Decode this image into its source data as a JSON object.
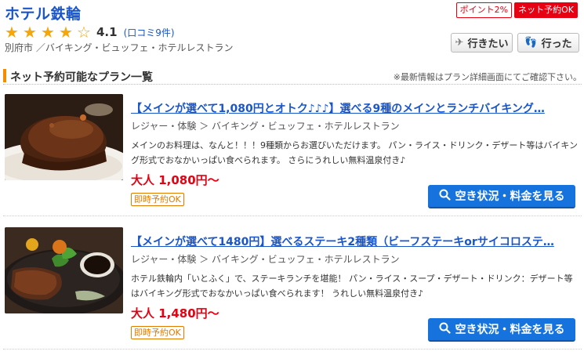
{
  "shop": {
    "name": "ホテル鉄輪",
    "rating": "4.1",
    "stars_filled": 4,
    "stars_total": 5,
    "review_link": "(口コミ9件)",
    "breadcrumb": "別府市 ／バイキング・ビュッフェ・ホテルレストラン"
  },
  "badges": {
    "point": "ポイント2%",
    "net": "ネット予約OK"
  },
  "actions": {
    "want_label": "行きたい",
    "went_label": "行った"
  },
  "section": {
    "title": "ネット予約可能なプラン一覧",
    "note": "※最新情報はプラン詳細画面にてご確認下さい。"
  },
  "plans": [
    {
      "title": "【メインが選べて1,080円とオトク♪♪♪】選べる9種のメインとランチバイキング…",
      "category": "レジャー・体験 ＞ バイキング・ビュッフェ・ホテルレストラン",
      "description": "メインのお料理は、なんと！！！9種類からお選びいただけます。 パン・ライス・ドリンク・デザート等はバイキング形式でおなかいっぱい食べられます。 さらにうれしい無料温泉付き♪",
      "price": "大人 1,080円～",
      "tag": "即時予約OK",
      "button": "空き状況・料金を見る",
      "image_icon": "hamburg-steak-photo"
    },
    {
      "title": "【メインが選べて1480円】選べるステーキ2種類（ビーフステーキorサイコロステ…",
      "category": "レジャー・体験 ＞ バイキング・ビュッフェ・ホテルレストラン",
      "description": "ホテル鉄輪内「いとふく」で、ステーキランチを堪能！ パン・ライス・スープ・デザート・ドリンク：デザート等はバイキング形式でおなかいっぱい食べられます！ うれしい無料温泉付き♪",
      "price": "大人 1,480円～",
      "tag": "即時予約OK",
      "button": "空き状況・料金を見る",
      "image_icon": "beef-steak-photo"
    }
  ],
  "colors": {
    "link": "#1a56c9",
    "price": "#e60012",
    "star": "#f5a60a",
    "accent_bar": "#f28c00",
    "button": "#1673de"
  }
}
